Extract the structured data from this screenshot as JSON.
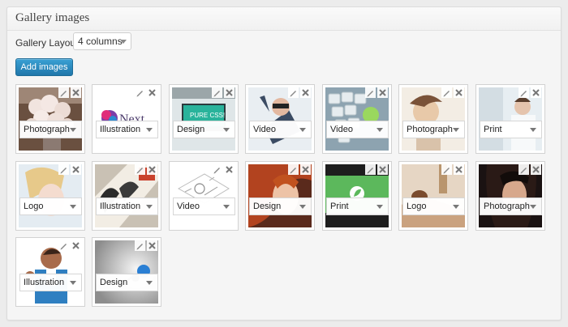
{
  "panel": {
    "title": "Gallery images"
  },
  "layout": {
    "label": "Gallery Layout:",
    "value": "4 columns"
  },
  "add_button": {
    "label": "Add images"
  },
  "images": [
    {
      "category": "Photograph"
    },
    {
      "category": "Illustration",
      "overlay_text": "Next"
    },
    {
      "category": "Design",
      "overlay_text": "PURE CSS!"
    },
    {
      "category": "Video"
    },
    {
      "category": "Video"
    },
    {
      "category": "Photograph"
    },
    {
      "category": "Print"
    },
    {
      "category": "Logo"
    },
    {
      "category": "Illustration"
    },
    {
      "category": "Video"
    },
    {
      "category": "Design"
    },
    {
      "category": "Print"
    },
    {
      "category": "Logo"
    },
    {
      "category": "Photograph"
    },
    {
      "category": "Illustration"
    },
    {
      "category": "Design"
    }
  ]
}
